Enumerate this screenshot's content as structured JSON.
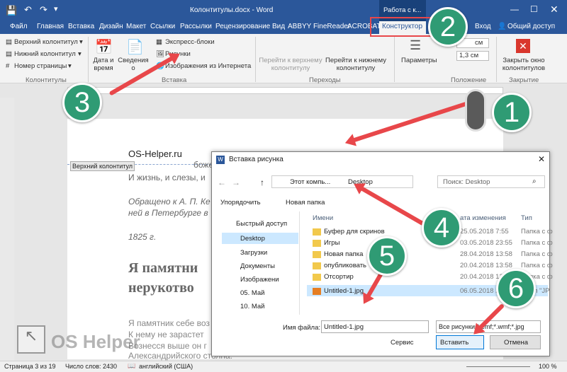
{
  "title": "Колонтитулы.docx - Word",
  "contextual_tab": "Работа с к...",
  "tabs": [
    "Файл",
    "Главная",
    "Вставка",
    "Дизайн",
    "Макет",
    "Ссылки",
    "Рассылки",
    "Рецензирование",
    "Вид",
    "ABBYY FineReader",
    "ACROBAT",
    "Конструктор",
    "Вход",
    "Общий доступ"
  ],
  "ribbon": {
    "header": "Верхний колонтитул",
    "footer": "Нижний колонтитул",
    "page_number": "Номер страницы",
    "group_headers": "Колонтитулы",
    "date_time": "Дата и время",
    "doc_info": "Сведения о документе",
    "express_blocks": "Экспресс-блоки",
    "pictures": "Рисунки",
    "online_pictures": "Изображения из Интернета",
    "group_insert": "Вставка",
    "goto_header": "Перейти к верхнему колонтитулу",
    "goto_footer": "Перейти к нижнему колонтитулу",
    "group_nav": "Переходы",
    "params": "Параметры",
    "pos1": "см",
    "pos2": "1,3 см",
    "group_position": "Положение",
    "close": "Закрыть окно колонтитулов",
    "group_close": "Закрытие"
  },
  "document": {
    "header_text": "OS-Helper.ru",
    "header_tag": "Верхний колонтитул",
    "line1": "божество, и вдохн",
    "line2": "И жизнь, и слезы, и",
    "italic1": "Обращено к А. П. Ке",
    "italic2": "ней в Петербурге в",
    "year": "1825 г.",
    "heading1": "Я памятни",
    "heading2": "нерукотво",
    "body1": "Я памятник себе воз",
    "body2": "К нему не зарастет",
    "body3": "Вознесся выше он г",
    "body4": "Александрийского столпа."
  },
  "status": {
    "page": "Страница 3 из 19",
    "words": "Число слов: 2430",
    "lang": "английский (США)",
    "zoom": "100 %"
  },
  "dialog": {
    "title": "Вставка рисунка",
    "breadcrumb1": "Этот компь...",
    "breadcrumb2": "Desktop",
    "search": "Поиск: Desktop",
    "organize": "Упорядочить",
    "new_folder": "Новая папка",
    "nav": [
      "Быстрый доступ",
      "Desktop",
      "Загрузки",
      "Документы",
      "Изображени",
      "05. Май",
      "10. Май"
    ],
    "col_name": "Имени",
    "col_date": "ата изменения",
    "col_type": "Тип",
    "files": [
      {
        "name": "Буфер для скринов",
        "date": "25.05.2018 7:55",
        "type": "Папка с ф"
      },
      {
        "name": "Игры",
        "date": "03.05.2018 23:55",
        "type": "Папка с ф"
      },
      {
        "name": "Новая папка",
        "date": "28.04.2018 13:58",
        "type": "Папка с ф"
      },
      {
        "name": "опубликовать",
        "date": "20.04.2018 13:58",
        "type": "Папка с ф"
      },
      {
        "name": "Отсортир",
        "date": "20.04.2018 13:58",
        "type": "Папка с ф"
      },
      {
        "name": "Untitled-1.jpg",
        "date": "06.05.2018 22:53",
        "type": "Файл \"JP"
      }
    ],
    "filename_label": "Имя файла:",
    "filename_value": "Untitled-1.jpg",
    "filter": "Все рисунки(*.emf;*.wmf;*.jpg",
    "service": "Сервис",
    "insert": "Вставить",
    "cancel": "Отмена"
  },
  "watermark": "OS Helper",
  "badges": [
    "1",
    "2",
    "3",
    "4",
    "5",
    "6"
  ],
  "colors": {
    "accent": "#2b579a",
    "badge": "#2f9b74",
    "arrow": "#e8474a"
  }
}
